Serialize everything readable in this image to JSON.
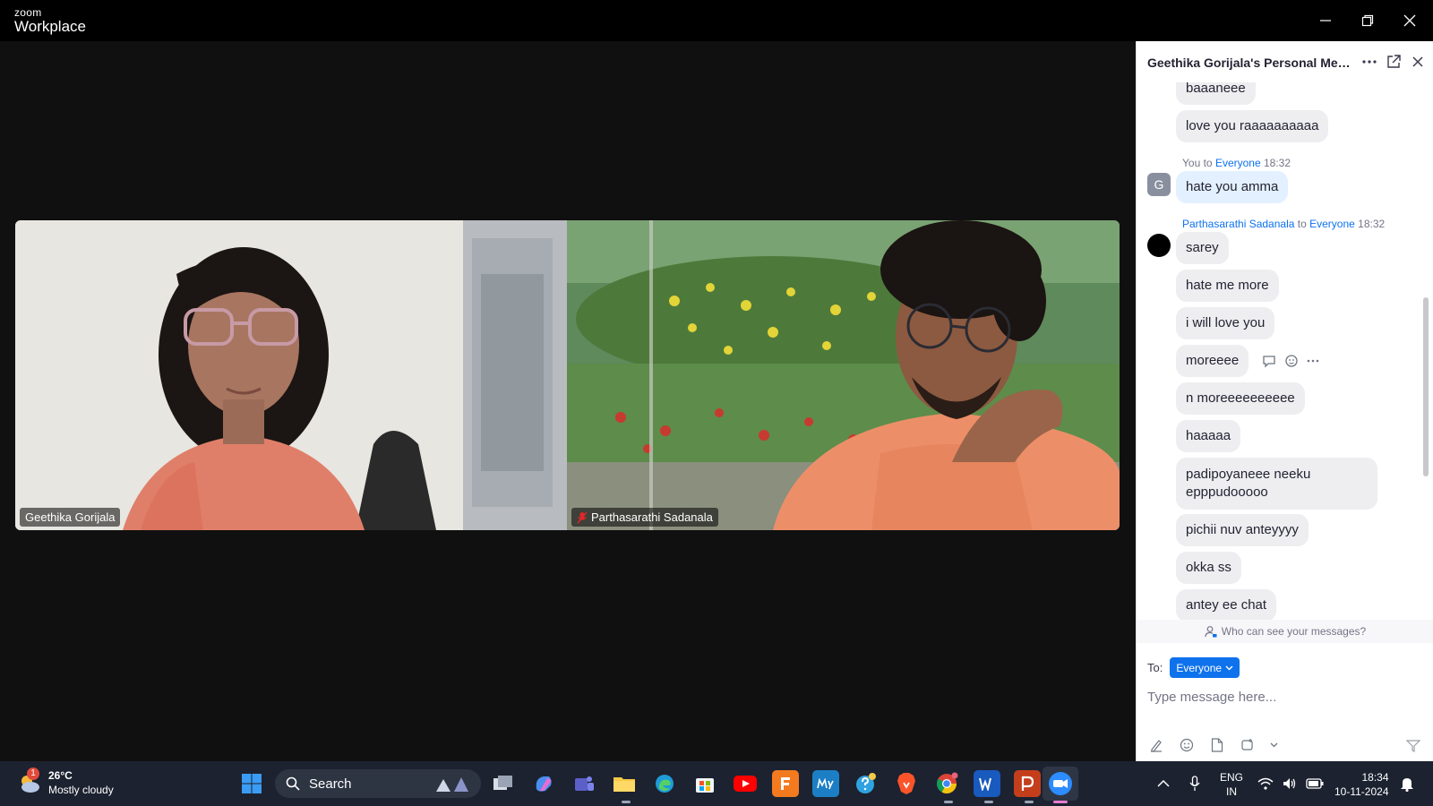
{
  "app": {
    "brand_small": "zoom",
    "brand_large": "Workplace"
  },
  "participants": [
    {
      "name": "Geethika Gorijala",
      "muted": false
    },
    {
      "name": "Parthasarathi Sadanala",
      "muted": true
    }
  ],
  "chat": {
    "title": "Geethika Gorijala's Personal Meet...",
    "messages": [
      {
        "text": "baaaneee"
      },
      {
        "text": "love you raaaaaaaaaa"
      },
      {
        "sender": "You",
        "to_word": "to",
        "recipient": "Everyone",
        "time": "18:32",
        "avatar_letter": "G",
        "text": "hate you amma"
      },
      {
        "sender": "Parthasarathi Sadanala",
        "to_word": "to",
        "recipient": "Everyone",
        "time": "18:32",
        "text": "sarey"
      },
      {
        "text": "hate me more"
      },
      {
        "text": "i will love you"
      },
      {
        "text": "moreeee"
      },
      {
        "text": "n moreeeeeeeeee"
      },
      {
        "text": "haaaaa"
      },
      {
        "text": "padipoyaneee neeku epppudooooo"
      },
      {
        "text": "pichii nuv anteyyyy"
      },
      {
        "text": "okka ss"
      },
      {
        "text": "antey ee chat"
      }
    ],
    "privacy_note": "Who can see your messages?",
    "to_label": "To:",
    "recipient_selector": "Everyone",
    "input_placeholder": "Type message here..."
  },
  "taskbar": {
    "weather": {
      "badge": "1",
      "temp": "26°C",
      "condition": "Mostly cloudy"
    },
    "search_label": "Search",
    "lang_line1": "ENG",
    "lang_line2": "IN",
    "time": "18:34",
    "date": "10-11-2024"
  },
  "colors": {
    "zoom_blue": "#0e72ed",
    "chat_bubble": "#eeeef1",
    "own_bubble": "#e3f0ff",
    "taskbar": "#1c2230"
  }
}
